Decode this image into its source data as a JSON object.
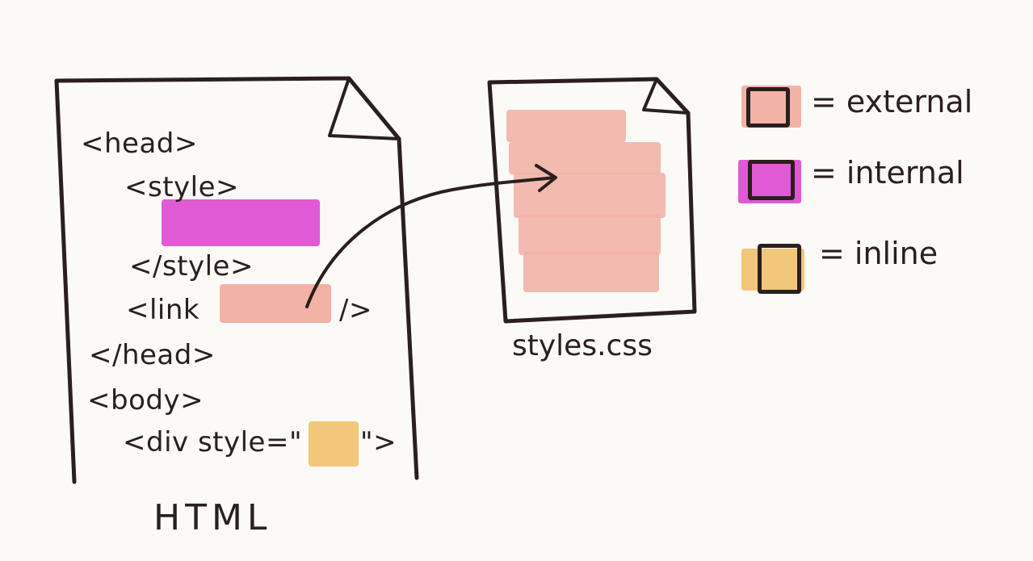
{
  "html_doc": {
    "label": "HTML",
    "lines": [
      "<head>",
      "<style>",
      "</style>",
      "<link",
      "/>",
      "</head>",
      "<body>",
      "<div style=\"",
      "\">"
    ]
  },
  "css_doc": {
    "label": "styles.css"
  },
  "legend": {
    "items": [
      {
        "label": "= external",
        "color": "#f2b2a6"
      },
      {
        "label": "= internal",
        "color": "#e05ad6"
      },
      {
        "label": "= inline",
        "color": "#f2c77a"
      }
    ]
  },
  "colors": {
    "external": "#f2b2a6",
    "internal": "#e05ad6",
    "inline": "#f2c77a",
    "ink": "#2a1f1c"
  }
}
